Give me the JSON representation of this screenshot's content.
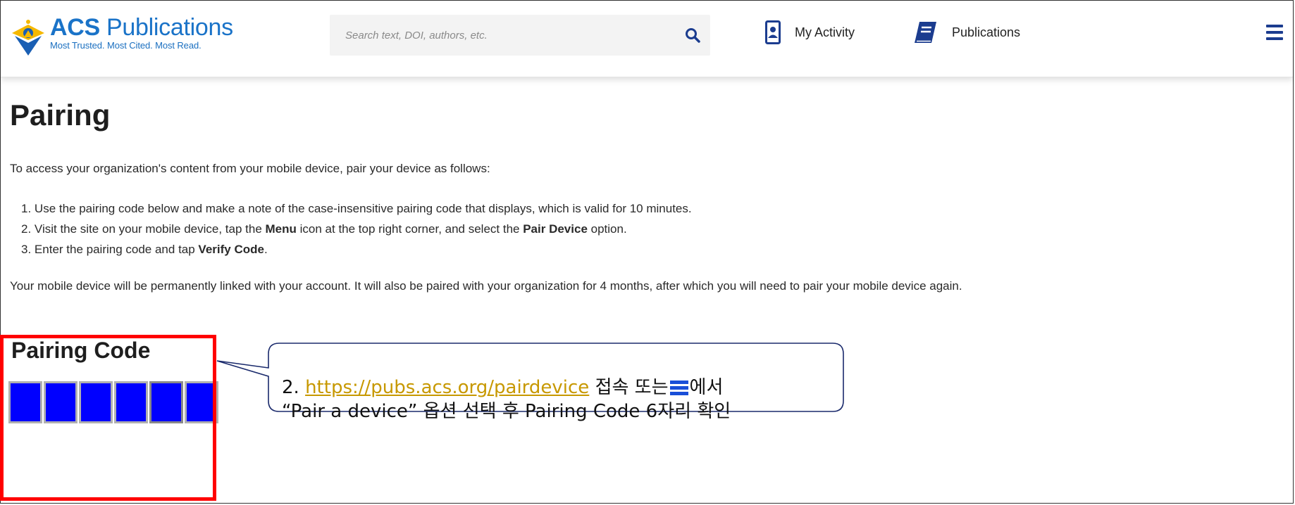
{
  "header": {
    "logo": {
      "brand_bold": "ACS",
      "brand_rest": "Publications",
      "tagline": "Most Trusted. Most Cited. Most Read."
    },
    "search": {
      "placeholder": "Search text, DOI, authors, etc.",
      "value": "",
      "icon": "search-icon"
    },
    "nav": [
      {
        "label": "My Activity",
        "icon": "id-badge-icon"
      },
      {
        "label": "Publications",
        "icon": "book-icon"
      }
    ],
    "menu_icon": "hamburger-menu-icon"
  },
  "main": {
    "title": "Pairing",
    "intro": "To access your organization's content from your mobile device, pair your device as follows:",
    "steps": [
      {
        "num": "1.",
        "text": "Use the pairing code below and make a note of the case-insensitive pairing code that displays, which is valid for 10 minutes."
      },
      {
        "num": "2.",
        "pre": "Visit the site on your mobile device, tap the ",
        "b1": "Menu",
        "mid": " icon at the top right corner, and select the ",
        "b2": "Pair Device",
        "post": " option."
      },
      {
        "num": "3.",
        "pre": "Enter the pairing code and tap ",
        "b1": "Verify Code",
        "post": "."
      }
    ],
    "note": "Your mobile device will be permanently linked with your account. It will also be paired with your organization for 4 months, after which you will need to pair your mobile device again.",
    "pairing_code": {
      "title": "Pairing Code",
      "cells": 6,
      "cell_color": "#0000ff"
    }
  },
  "callout": {
    "prefix": "2. ",
    "link": "https://pubs.acs.org/pairdevice",
    "line1_rest": " 접속 또는",
    "line1_end": "에서",
    "line2": "“Pair a device” 옵션 선택 후 Pairing Code 6자리 확인",
    "highlight_color": "#ff0000",
    "link_color": "#c79800"
  },
  "colors": {
    "brand_blue": "#1a73c8",
    "menu_navy": "#1b3c8f"
  }
}
